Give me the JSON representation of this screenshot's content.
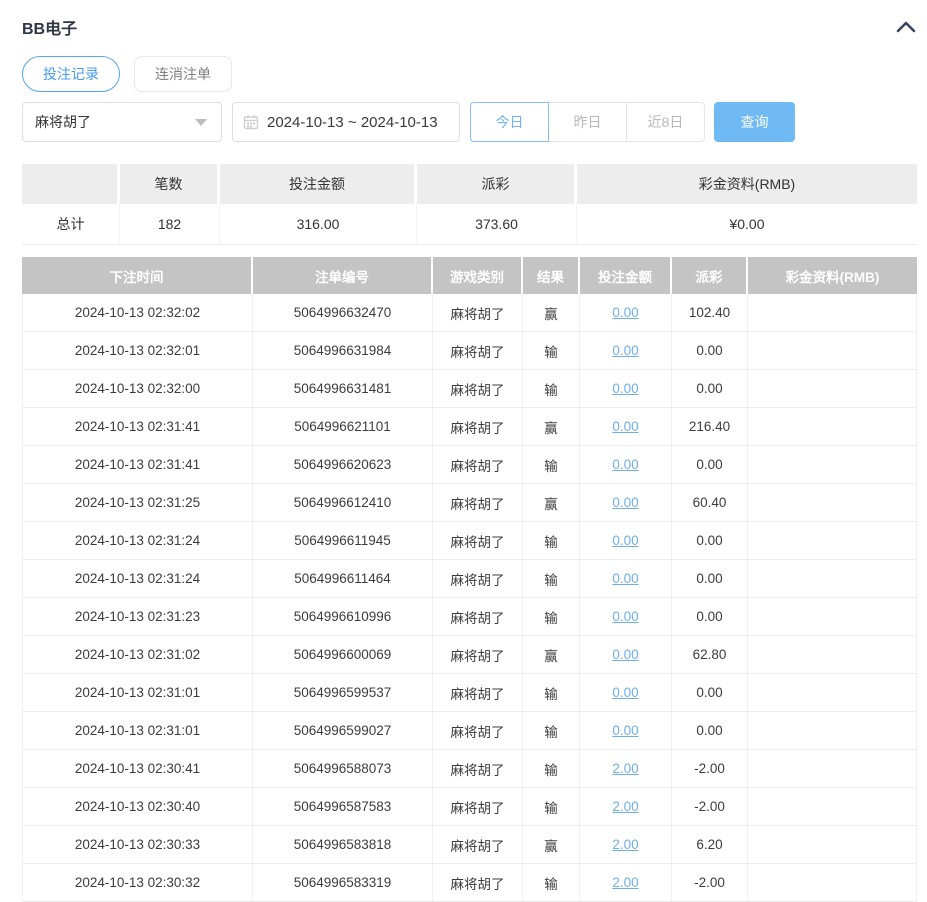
{
  "header": {
    "title": "BB电子"
  },
  "tabs": [
    {
      "label": "投注记录",
      "active": true
    },
    {
      "label": "连消注单",
      "active": false
    }
  ],
  "filters": {
    "game_select": {
      "value": "麻将胡了"
    },
    "date_range": {
      "value": "2024-10-13 ~ 2024-10-13"
    },
    "quick_buttons": [
      {
        "label": "今日",
        "active": true
      },
      {
        "label": "昨日",
        "active": false
      },
      {
        "label": "近8日",
        "active": false
      }
    ],
    "search_label": "查询"
  },
  "summary": {
    "headers": [
      "",
      "笔数",
      "投注金额",
      "派彩",
      "彩金资料(RMB)"
    ],
    "row": {
      "label": "总计",
      "count": "182",
      "bet_amount": "316.00",
      "payout": "373.60",
      "jackpot": "¥0.00"
    }
  },
  "table": {
    "headers": [
      "下注时间",
      "注单编号",
      "游戏类别",
      "结果",
      "投注金额",
      "派彩",
      "彩金资料(RMB)"
    ],
    "rows": [
      {
        "time": "2024-10-13 02:32:02",
        "order_id": "5064996632470",
        "game": "麻将胡了",
        "result": "赢",
        "bet": "0.00",
        "payout": "102.40",
        "jackpot": ""
      },
      {
        "time": "2024-10-13 02:32:01",
        "order_id": "5064996631984",
        "game": "麻将胡了",
        "result": "输",
        "bet": "0.00",
        "payout": "0.00",
        "jackpot": ""
      },
      {
        "time": "2024-10-13 02:32:00",
        "order_id": "5064996631481",
        "game": "麻将胡了",
        "result": "输",
        "bet": "0.00",
        "payout": "0.00",
        "jackpot": ""
      },
      {
        "time": "2024-10-13 02:31:41",
        "order_id": "5064996621101",
        "game": "麻将胡了",
        "result": "赢",
        "bet": "0.00",
        "payout": "216.40",
        "jackpot": ""
      },
      {
        "time": "2024-10-13 02:31:41",
        "order_id": "5064996620623",
        "game": "麻将胡了",
        "result": "输",
        "bet": "0.00",
        "payout": "0.00",
        "jackpot": ""
      },
      {
        "time": "2024-10-13 02:31:25",
        "order_id": "5064996612410",
        "game": "麻将胡了",
        "result": "赢",
        "bet": "0.00",
        "payout": "60.40",
        "jackpot": ""
      },
      {
        "time": "2024-10-13 02:31:24",
        "order_id": "5064996611945",
        "game": "麻将胡了",
        "result": "输",
        "bet": "0.00",
        "payout": "0.00",
        "jackpot": ""
      },
      {
        "time": "2024-10-13 02:31:24",
        "order_id": "5064996611464",
        "game": "麻将胡了",
        "result": "输",
        "bet": "0.00",
        "payout": "0.00",
        "jackpot": ""
      },
      {
        "time": "2024-10-13 02:31:23",
        "order_id": "5064996610996",
        "game": "麻将胡了",
        "result": "输",
        "bet": "0.00",
        "payout": "0.00",
        "jackpot": ""
      },
      {
        "time": "2024-10-13 02:31:02",
        "order_id": "5064996600069",
        "game": "麻将胡了",
        "result": "赢",
        "bet": "0.00",
        "payout": "62.80",
        "jackpot": ""
      },
      {
        "time": "2024-10-13 02:31:01",
        "order_id": "5064996599537",
        "game": "麻将胡了",
        "result": "输",
        "bet": "0.00",
        "payout": "0.00",
        "jackpot": ""
      },
      {
        "time": "2024-10-13 02:31:01",
        "order_id": "5064996599027",
        "game": "麻将胡了",
        "result": "输",
        "bet": "0.00",
        "payout": "0.00",
        "jackpot": ""
      },
      {
        "time": "2024-10-13 02:30:41",
        "order_id": "5064996588073",
        "game": "麻将胡了",
        "result": "输",
        "bet": "2.00",
        "payout": "-2.00",
        "jackpot": ""
      },
      {
        "time": "2024-10-13 02:30:40",
        "order_id": "5064996587583",
        "game": "麻将胡了",
        "result": "输",
        "bet": "2.00",
        "payout": "-2.00",
        "jackpot": ""
      },
      {
        "time": "2024-10-13 02:30:33",
        "order_id": "5064996583818",
        "game": "麻将胡了",
        "result": "赢",
        "bet": "2.00",
        "payout": "6.20",
        "jackpot": ""
      },
      {
        "time": "2024-10-13 02:30:32",
        "order_id": "5064996583319",
        "game": "麻将胡了",
        "result": "输",
        "bet": "2.00",
        "payout": "-2.00",
        "jackpot": ""
      }
    ]
  },
  "colors": {
    "accent_blue": "#459df0",
    "button_blue": "#6fb9f4",
    "link_blue": "#6fafe8",
    "negative_red": "#ed5565",
    "table_header_bg": "#c4c4c4",
    "summary_header_bg": "#ededed"
  }
}
